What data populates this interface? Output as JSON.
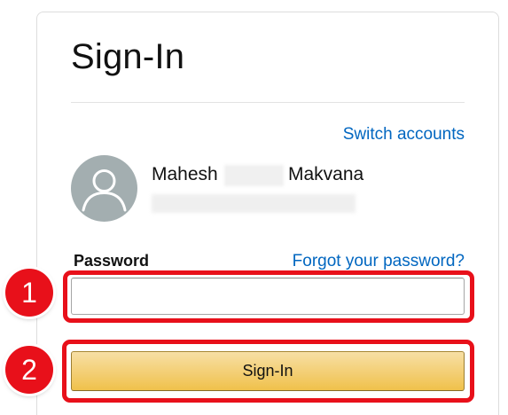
{
  "page": {
    "title": "Sign-In"
  },
  "account": {
    "switch_label": "Switch accounts",
    "first_name": "Mahesh",
    "last_name": "Makvana"
  },
  "password": {
    "label": "Password",
    "forgot_label": "Forgot your password?",
    "value": "",
    "placeholder": ""
  },
  "actions": {
    "signin_label": "Sign-In"
  },
  "annotations": {
    "step_1": "1",
    "step_2": "2"
  },
  "colors": {
    "link": "#0066c0",
    "button_top": "#f7dfa5",
    "button_bottom": "#f0c14b",
    "annotation_red": "#e8101a",
    "avatar_bg": "#a3aeb0"
  },
  "icons": {
    "avatar": "user-silhouette-icon"
  }
}
